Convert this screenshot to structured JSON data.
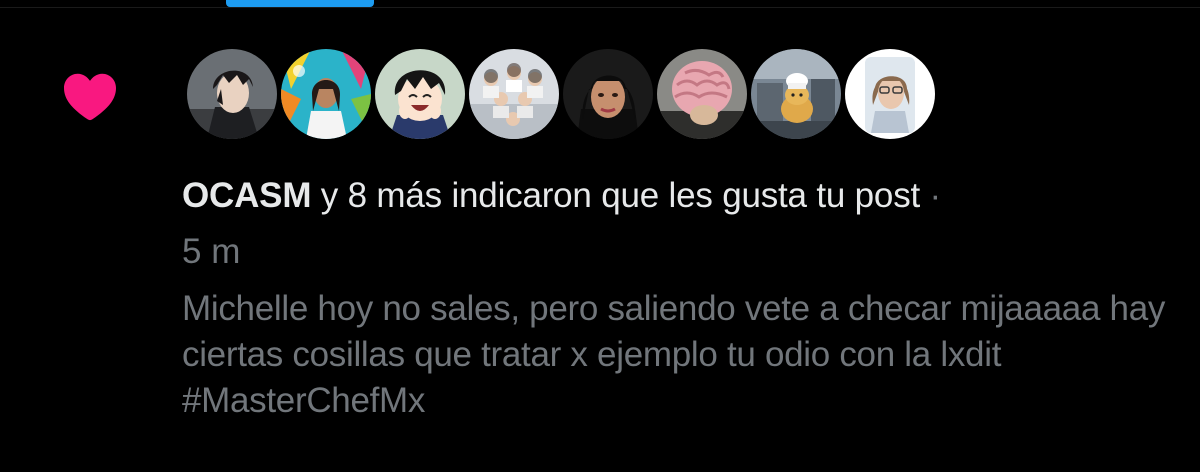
{
  "notification": {
    "type_icon": "heart-icon",
    "liker_name": "OCASM",
    "summary_rest": " y 8 más indicaron que les gusta tu post",
    "separator": " ·",
    "timestamp": "5 m",
    "post_text": "Michelle hoy no sales, pero saliendo vete a checar mijaaaaa hay ciertas cosillas que tratar x ejemplo tu odio con la lxdit #MasterChefMx",
    "avatars": [
      {
        "label": "avatar-anime-dark-hair"
      },
      {
        "label": "avatar-woman-colorful-background"
      },
      {
        "label": "avatar-anime-laughing"
      },
      {
        "label": "avatar-group-photo"
      },
      {
        "label": "avatar-woman-dark-hair"
      },
      {
        "label": "avatar-brain-mask"
      },
      {
        "label": "avatar-kitchen-doge-chef"
      },
      {
        "label": "avatar-woman-selfie"
      }
    ]
  },
  "colors": {
    "background": "#000000",
    "heart": "#f91880",
    "primary_text": "#e7e9ea",
    "secondary_text": "#71767b",
    "accent": "#1d9bf0"
  }
}
